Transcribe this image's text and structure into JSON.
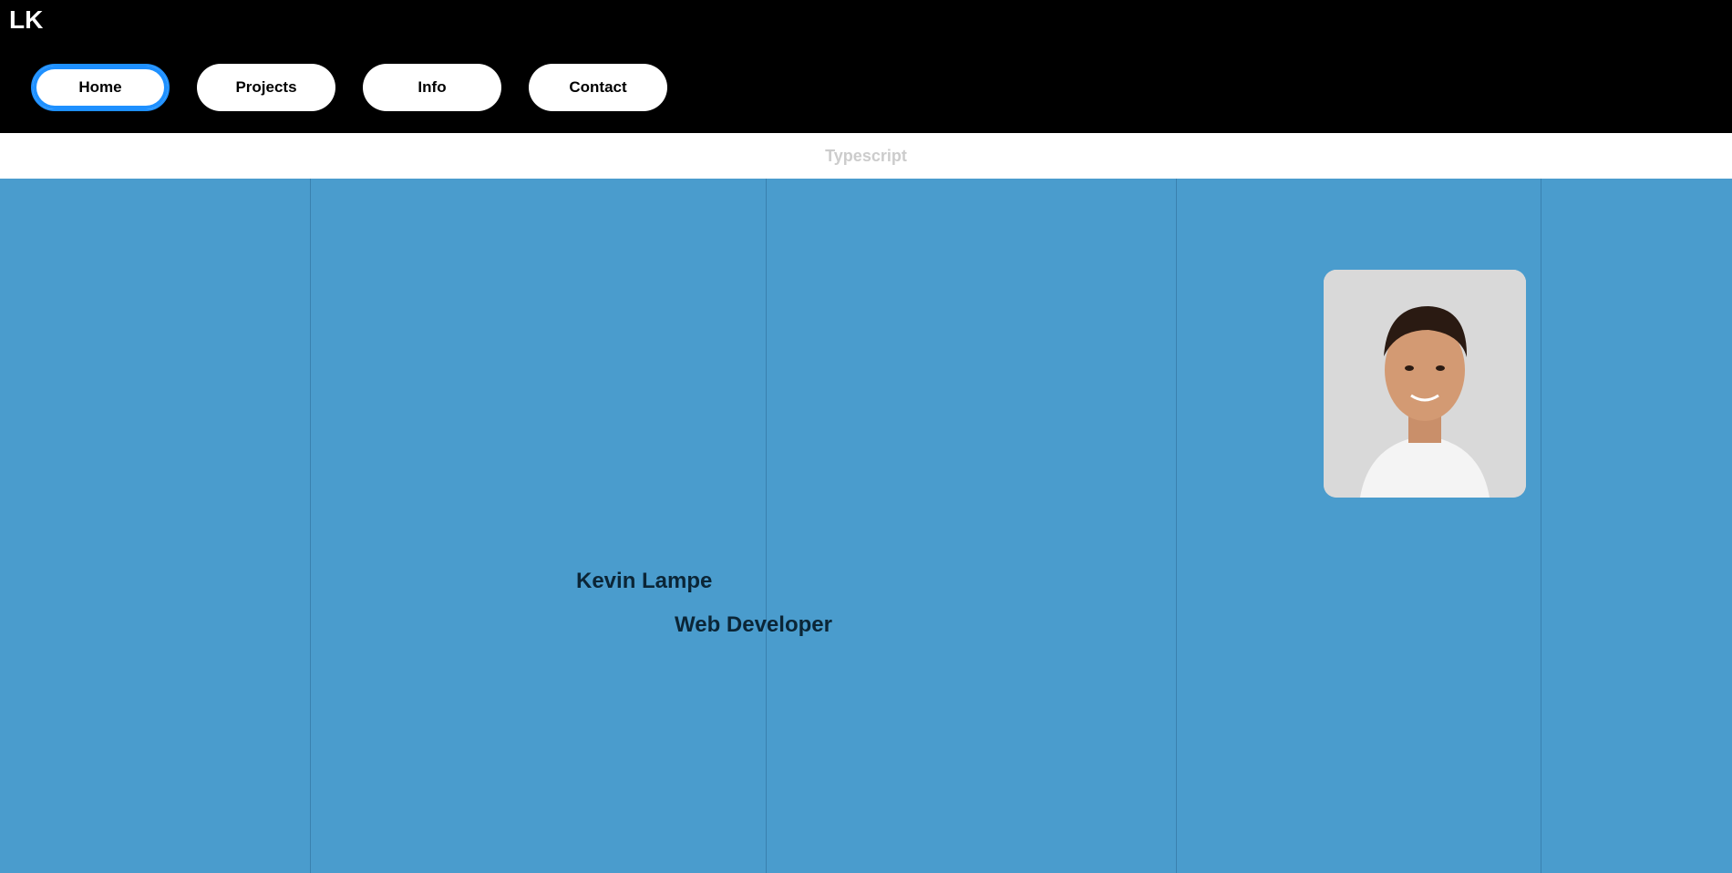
{
  "logo": "LK",
  "nav": [
    {
      "label": "Home"
    },
    {
      "label": "Projects"
    },
    {
      "label": "Info"
    },
    {
      "label": "Contact"
    }
  ],
  "subbar_text": "Typescript",
  "hero": {
    "name": "Kevin Lampe",
    "role": "Web Developer"
  },
  "colors": {
    "accent": "#1e90ff",
    "background": "#4a9fcf",
    "topbar": "#000000"
  }
}
